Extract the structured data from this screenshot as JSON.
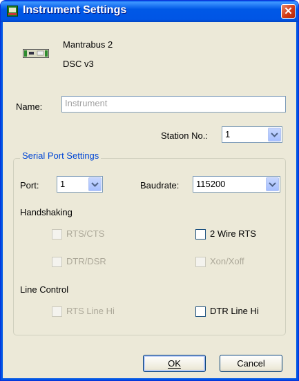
{
  "window": {
    "title": "Instrument Settings",
    "close_label": "✕"
  },
  "device": {
    "model": "Mantrabus 2",
    "version": "DSC v3"
  },
  "name_field": {
    "label": "Name:",
    "placeholder": "Instrument"
  },
  "station": {
    "label": "Station No.:",
    "value": "1"
  },
  "serial_port": {
    "title": "Serial Port Settings",
    "port_label": "Port:",
    "port_value": "1",
    "baudrate_label": "Baudrate:",
    "baudrate_value": "115200"
  },
  "handshaking": {
    "title": "Handshaking",
    "rts_cts": "RTS/CTS",
    "two_wire_rts": "2 Wire RTS",
    "dtr_dsr": "DTR/DSR",
    "xon_xoff": "Xon/Xoff"
  },
  "line_control": {
    "title": "Line Control",
    "rts_line_hi": "RTS Line Hi",
    "dtr_line_hi": "DTR Line Hi"
  },
  "buttons": {
    "ok": "OK",
    "cancel": "Cancel"
  },
  "colors": {
    "titlebar": "#0055e5",
    "group_title": "#0046d5",
    "face": "#ece9d8",
    "disabled_text": "#aca899"
  }
}
